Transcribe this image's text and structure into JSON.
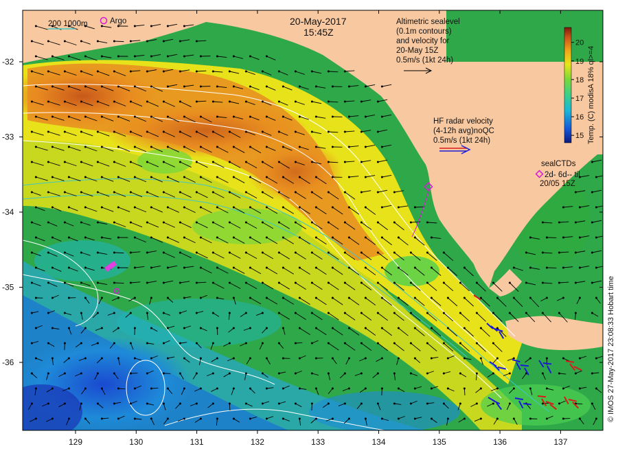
{
  "title": {
    "date": "20-May-2017",
    "time": "15:45Z"
  },
  "legend_top_left": {
    "scale_label": "200  1000m",
    "argo_label": "Argo"
  },
  "altimetry": {
    "line1": "Altimetric sealevel",
    "line2": "(0.1m contours)",
    "line3": "and velocity for",
    "line4": "20-May 15Z",
    "line5": "0.5m/s (1kt 24h)"
  },
  "hf_radar": {
    "line1": "HF radar velocity",
    "line2": "(4-12h avg)noQC",
    "line3": "0.5m/s (1kt 24h)"
  },
  "seal_ctd": {
    "line1": "sealCTDs",
    "line2": "2d- 6d-- til",
    "line3": "20/05 15Z"
  },
  "colorbar": {
    "label": "Temp. (C) modisA 18% ql>=4",
    "ticks": [
      "20",
      "19",
      "18",
      "17",
      "16",
      "15"
    ],
    "min": 14.6,
    "max": 20.8
  },
  "axes": {
    "x_ticks": [
      "129",
      "130",
      "131",
      "132",
      "133",
      "134",
      "135",
      "136",
      "137"
    ],
    "y_ticks": [
      "-32",
      "-33",
      "-34",
      "-35",
      "-36"
    ]
  },
  "credit": "© IMOS 27-May-2017 23:08:33 Hobart time",
  "colors": {
    "land": "#f8c8a0",
    "contour": "#ffffff",
    "arrow": "#000000",
    "hf_blue": "#1a1ad8",
    "hf_red": "#d81a1a",
    "argo": "#d81ad8",
    "isobath": "#3fc7c7"
  }
}
